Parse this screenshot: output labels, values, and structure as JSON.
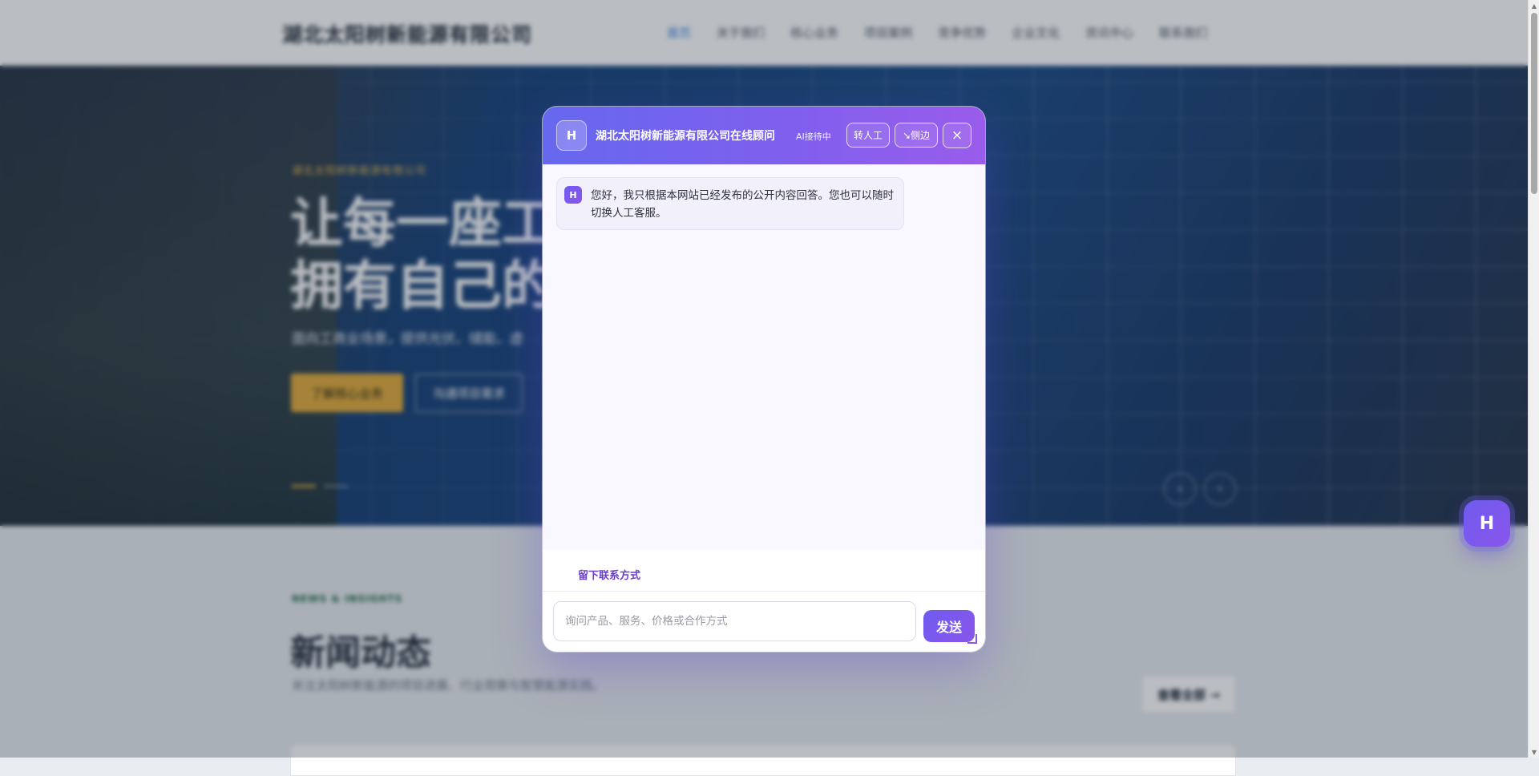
{
  "site": {
    "brand": "湖北太阳树新能源有限公司",
    "nav": [
      "首页",
      "关于我们",
      "核心业务",
      "项目案例",
      "竞争优势",
      "企业文化",
      "资讯中心",
      "联系我们"
    ],
    "hero": {
      "eyebrow": "湖北太阳树新能源有限公司",
      "title_line1": "让每一座工",
      "title_line2": "拥有自己的",
      "subtitle": "面向工商业场景，提供光伏、储能、虚",
      "primary_button": "了解核心业务",
      "secondary_button": "沟通项目需求",
      "prev_arrow": "‹",
      "next_arrow": "›"
    },
    "news": {
      "eyebrow": "NEWS & INSIGHTS",
      "title": "新闻动态",
      "subtitle": "关注太阳树新能源的项目进展、行业观察与智慧能源实践。",
      "more_button": "查看全部 →"
    }
  },
  "scrollbar": {
    "up": "▲",
    "down": "▼"
  },
  "launcher": {
    "label": "H"
  },
  "chat": {
    "avatar": "H",
    "title": "湖北太阳树新能源有限公司在线顾问",
    "status": "AI接待中",
    "human_button": "转人工",
    "side_button": "↘侧边",
    "close_button": "×",
    "messages": [
      {
        "avatar": "H",
        "text": "您好，我只根据本网站已经发布的公开内容回答。您也可以随时切换人工客服。"
      }
    ],
    "contact_link": "留下联系方式",
    "input_placeholder": "询问产品、服务、价格或合作方式",
    "input_value": "",
    "send_button": "发送"
  }
}
